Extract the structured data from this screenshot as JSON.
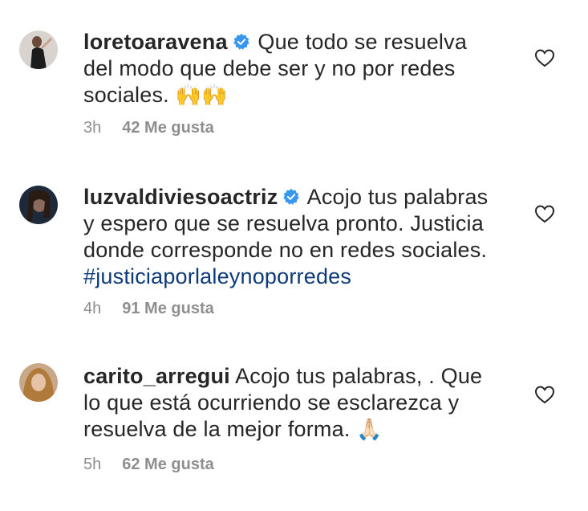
{
  "comments": [
    {
      "username": "loretoaravena",
      "verified": true,
      "text": "Que todo se resuelva del modo que debe ser y no por redes sociales.",
      "emoji": "🙌🙌",
      "time": "3h",
      "likes": "42 Me gusta"
    },
    {
      "username": "luzvaldiviesoactriz",
      "verified": true,
      "text": "Acojo tus palabras y espero que se resuelva pronto. Justicia donde corresponde no en redes sociales.",
      "hashtag": "#justiciaporlaleynoporredes",
      "time": "4h",
      "likes": "91 Me gusta"
    },
    {
      "username": "carito_arregui",
      "verified": false,
      "text": "Acojo tus palabras, . Que lo que está ocurriendo se esclarezca y resuelva de la mejor forma.",
      "emoji": "🙏🏻",
      "time": "5h",
      "likes": "62 Me gusta"
    }
  ],
  "icons": {
    "verified": "verified-badge-icon",
    "like": "heart-outline-icon"
  },
  "colors": {
    "text": "#262626",
    "meta": "#8e8e8e",
    "hashtag": "#0c3a79",
    "verified": "#3897f0"
  }
}
